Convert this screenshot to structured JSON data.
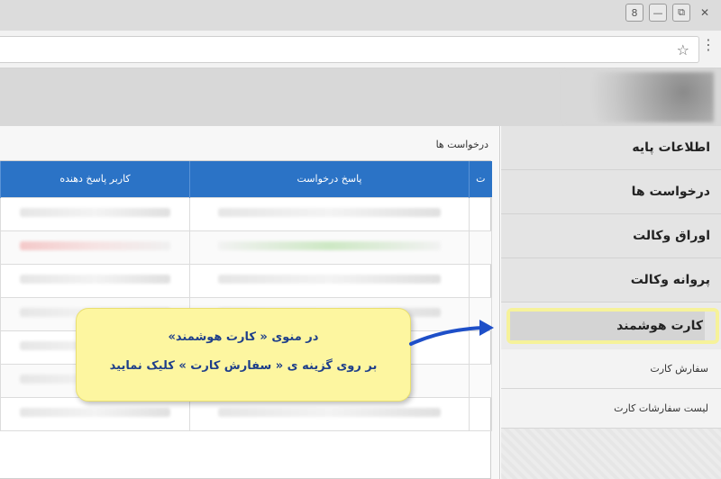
{
  "window": {
    "controls": [
      "8",
      "—",
      "⧉",
      "✕"
    ]
  },
  "browser": {
    "star_icon": "☆",
    "menu_icon": "⋮"
  },
  "panel": {
    "title": "درخواست ها",
    "columns": [
      "ت",
      "پاسخ درخواست",
      "کاربر پاسخ دهنده"
    ]
  },
  "sidebar": {
    "items": [
      {
        "label": "اطلاعات پایه"
      },
      {
        "label": "درخواست ها"
      },
      {
        "label": "اوراق وکالت"
      },
      {
        "label": "پروانه وکالت"
      },
      {
        "label": "کارت هوشمند"
      }
    ],
    "subitems": [
      {
        "label": "سفارش کارت"
      },
      {
        "label": "لیست سفارشات کارت"
      }
    ]
  },
  "callout": {
    "line1": "در منوی « کارت هوشمند»",
    "line2": "بر روی گزینه ی « سفارش کارت » کلیک نمایید"
  },
  "colors": {
    "header_blue": "#2b73c6",
    "callout_yellow": "#fdf6a0",
    "highlight_yellow": "#f6f29a",
    "arrow_blue": "#1e4fc8"
  }
}
